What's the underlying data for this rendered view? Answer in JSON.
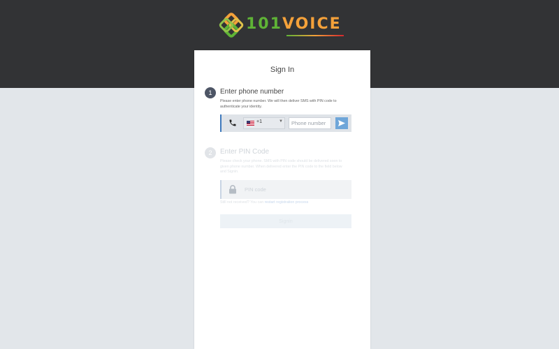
{
  "brand": {
    "logo_digits": "101",
    "logo_word": "VOICE"
  },
  "card": {
    "title": "Sign In"
  },
  "step1": {
    "number": "1",
    "title": "Enter phone number",
    "description": "Please enter phone number. We will then deliver SMS with PIN code to authenticate your identity.",
    "country_code": "+1",
    "country_flag": "us-flag-icon",
    "phone_placeholder": "Phone number",
    "phone_value": ""
  },
  "step2": {
    "number": "2",
    "title": "Enter PIN Code",
    "description": "Please check your phone. SMS with PIN code should be delivered soon to given phone number. When delivered enter the PIN code to the field below and Signin.",
    "pin_placeholder": "PIN code",
    "pin_value": "",
    "restart_prefix": "Still not received? You can",
    "restart_link": "restart registration process",
    "signin_label": "Signin"
  },
  "colors": {
    "header_bg": "#323335",
    "page_bg": "#e2e6ea",
    "step_badge_active": "#4d5565",
    "accent_blue": "#3e79bd",
    "send_button": "#6fa6d9",
    "logo_green": "#5fb336",
    "logo_orange": "#f4a13a"
  },
  "icons": {
    "phone": "phone-icon",
    "send": "send-arrow-icon",
    "lock": "lock-icon",
    "dropdown": "caret-down-icon"
  }
}
